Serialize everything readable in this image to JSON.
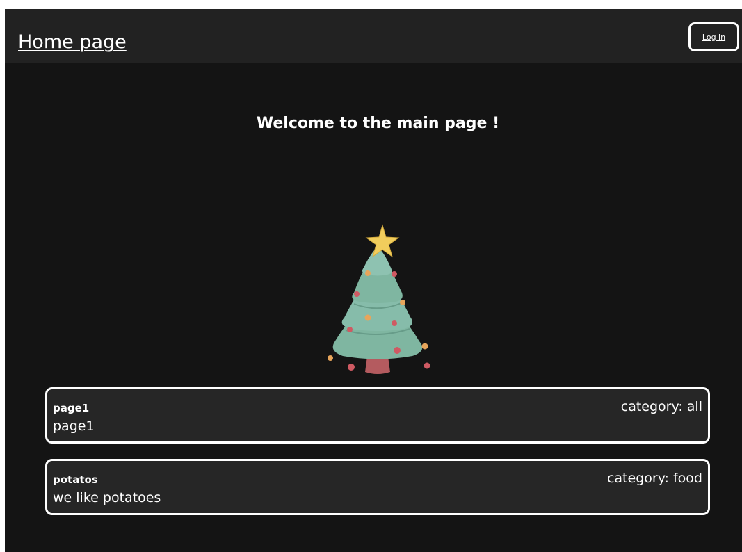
{
  "header": {
    "home_link": "Home page",
    "login_button": "Log in"
  },
  "main": {
    "welcome": "Welcome to the main page !",
    "image": "christmas-tree-illustration"
  },
  "posts": [
    {
      "title": "page1",
      "category_label": "category: all",
      "description": "page1"
    },
    {
      "title": "potatos",
      "category_label": "category: food",
      "description": "we like potatoes"
    }
  ],
  "colors": {
    "background": "#141414",
    "topbar": "#222222",
    "card": "#262626",
    "border": "#ffffff",
    "text": "#ffffff",
    "tree_green": "#7fb6a1",
    "star": "#f1cd5c",
    "trunk": "#b45b5f"
  }
}
